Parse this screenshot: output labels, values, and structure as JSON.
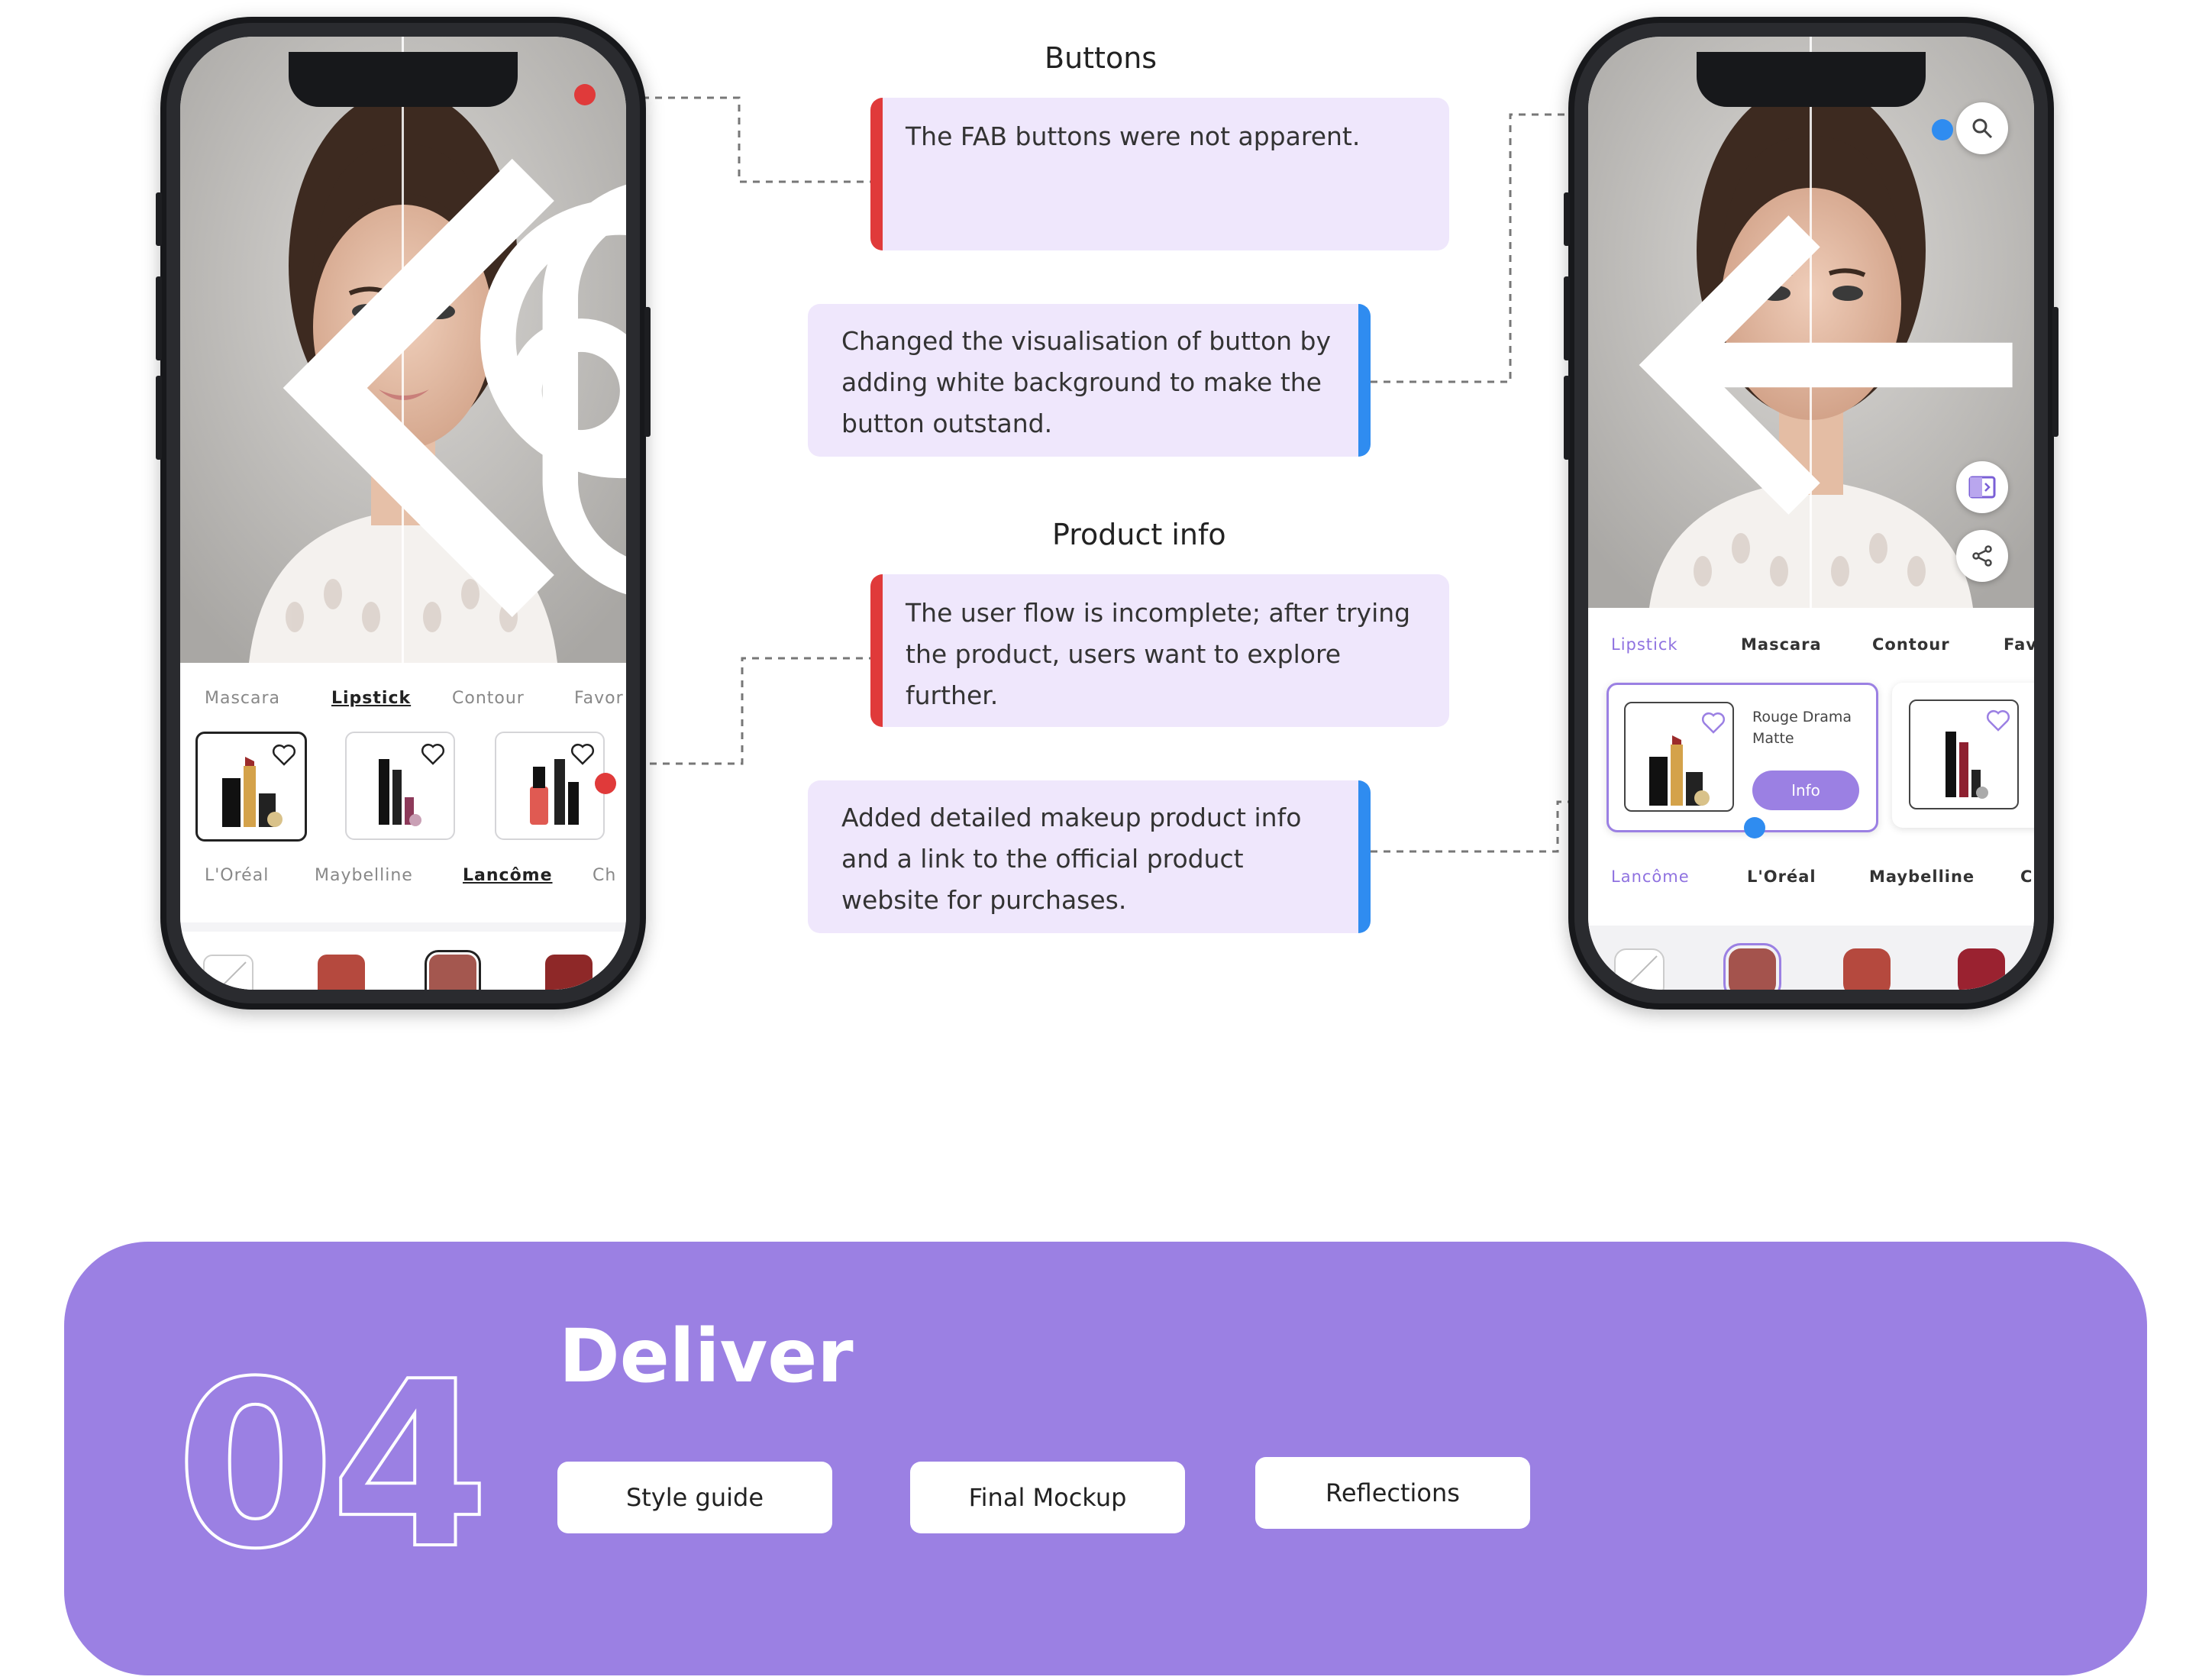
{
  "annotations": {
    "buttons_heading": "Buttons",
    "buttons_problem": "The FAB buttons were not apparent.",
    "buttons_solution": "Changed the visualisation of button by adding white background to make the button outstand.",
    "product_heading": "Product info",
    "product_problem": "The user flow is incomplete; after trying the product, users want to explore further.",
    "product_solution": "Added detailed makeup product info and a link to the official product website for purchases."
  },
  "before_screen": {
    "categories": [
      "Mascara",
      "Lipstick",
      "Contour",
      "Favor"
    ],
    "active_category": "Lipstick",
    "brands": [
      "L'Oréal",
      "Maybelline",
      "Lancôme",
      "Ch"
    ],
    "active_brand": "Lancôme",
    "shades": [
      "#b5493e",
      "#a4574f",
      "#8e2828"
    ]
  },
  "after_screen": {
    "categories": [
      "Lipstick",
      "Mascara",
      "Contour",
      "Fav"
    ],
    "active_category": "Lipstick",
    "product_name": "Rouge Drama Matte",
    "info_label": "Info",
    "brands": [
      "Lancôme",
      "L'Oréal",
      "Maybelline",
      "C"
    ],
    "active_brand": "Lancôme",
    "shades": [
      "#a4534d",
      "#b5493e",
      "#9a2230"
    ]
  },
  "deliver": {
    "number": "04",
    "title": "Deliver",
    "steps": [
      "Style guide",
      "Final Mockup",
      "Reflections"
    ]
  },
  "colors": {
    "accent_purple": "#9b80e3",
    "note_bg": "#efe7fc",
    "problem_red": "#e03a3a",
    "solution_blue": "#2f8cf0"
  }
}
